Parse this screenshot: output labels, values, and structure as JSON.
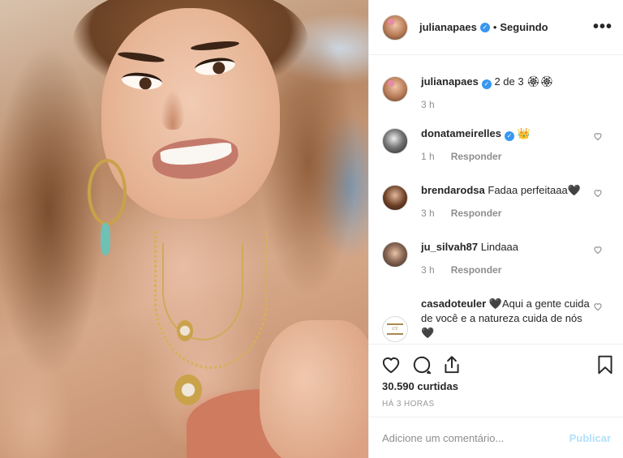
{
  "header": {
    "username": "julianapaes",
    "separator": "•",
    "follow_status": "Seguindo",
    "more_icon": "more-horizontal-icon"
  },
  "caption": {
    "username": "julianapaes",
    "text": "2 de 3 🏵🏵",
    "time": "3 h"
  },
  "comments": [
    {
      "username": "donatameirelles",
      "verified": true,
      "text": "👑",
      "time": "1 h",
      "reply": "Responder"
    },
    {
      "username": "brendarodsa",
      "verified": false,
      "text": "Fadaa perfeitaaa🖤",
      "time": "3 h",
      "reply": "Responder"
    },
    {
      "username": "ju_silvah87",
      "verified": false,
      "text": "Lindaaa",
      "time": "3 h",
      "reply": "Responder"
    },
    {
      "username": "casadoteuler",
      "verified": false,
      "text": "🖤Aqui a gente cuida de você e a natureza cuida de nós 🖤",
      "time": "",
      "reply": ""
    }
  ],
  "actions": {
    "likes": "30.590 curtidas",
    "time_ago": "HÁ 3 HORAS"
  },
  "add_comment": {
    "placeholder": "Adicione um comentário...",
    "publish": "Publicar"
  },
  "colors": {
    "verified": "#3897f0",
    "publish_disabled": "#b2dffc",
    "muted": "#8e8e8e"
  }
}
